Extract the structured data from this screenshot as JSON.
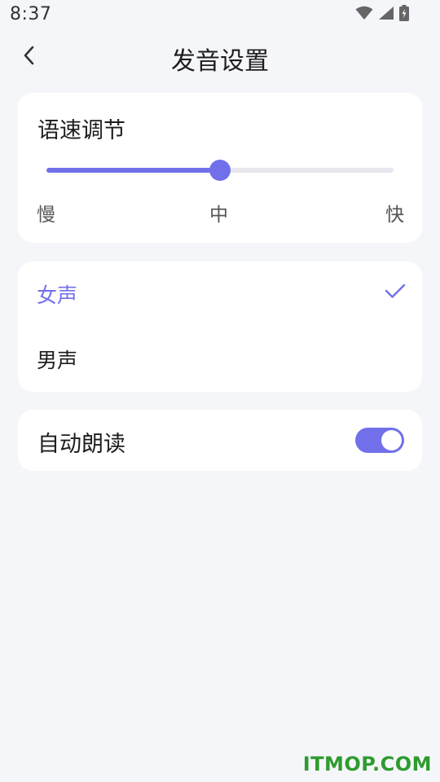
{
  "status_bar": {
    "time": "8:37",
    "icons": [
      "wifi-icon",
      "signal-icon",
      "battery-charging-icon"
    ]
  },
  "header": {
    "back_icon": "chevron-left-icon",
    "title": "发音设置"
  },
  "speed_card": {
    "title": "语速调节",
    "slider_value": 0.5,
    "labels": {
      "slow": "慢",
      "medium": "中",
      "fast": "快"
    }
  },
  "voice_card": {
    "options": [
      {
        "label": "女声",
        "selected": true
      },
      {
        "label": "男声",
        "selected": false
      }
    ],
    "check_icon": "check-icon"
  },
  "auto_read": {
    "label": "自动朗读",
    "enabled": true
  },
  "colors": {
    "accent": "#7170ea",
    "background": "#f5f6fa",
    "card": "#ffffff",
    "watermark": "#2e9b2e"
  },
  "watermark": "ITMOP.COM"
}
